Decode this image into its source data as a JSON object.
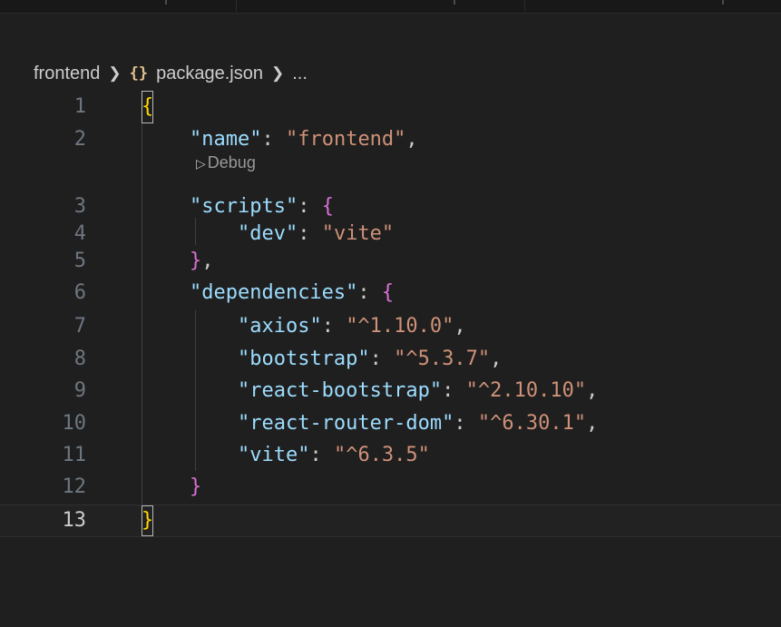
{
  "breadcrumb": {
    "folder": "frontend",
    "braces_icon": "{}",
    "file": "package.json",
    "ellipsis": "..."
  },
  "codelens": {
    "icon": "play-triangle",
    "label": "Debug"
  },
  "active_line": 13,
  "lines": [
    {
      "n": "1"
    },
    {
      "n": "2",
      "indent": "    ",
      "key": "\"name\"",
      "colon": ": ",
      "value": "\"frontend\"",
      "tail": ","
    },
    {
      "n": "3",
      "indent": "    ",
      "key": "\"scripts\"",
      "colon": ": ",
      "open": "{"
    },
    {
      "n": "4",
      "indent": "        ",
      "key": "\"dev\"",
      "colon": ": ",
      "value": "\"vite\""
    },
    {
      "n": "5",
      "indent": "    ",
      "close": "}",
      "tail": ","
    },
    {
      "n": "6",
      "indent": "    ",
      "key": "\"dependencies\"",
      "colon": ": ",
      "open": "{"
    },
    {
      "n": "7",
      "indent": "        ",
      "key": "\"axios\"",
      "colon": ": ",
      "value": "\"^1.10.0\"",
      "tail": ","
    },
    {
      "n": "8",
      "indent": "        ",
      "key": "\"bootstrap\"",
      "colon": ": ",
      "value": "\"^5.3.7\"",
      "tail": ","
    },
    {
      "n": "9",
      "indent": "        ",
      "key": "\"react-bootstrap\"",
      "colon": ": ",
      "value": "\"^2.10.10\"",
      "tail": ","
    },
    {
      "n": "10",
      "indent": "        ",
      "key": "\"react-router-dom\"",
      "colon": ": ",
      "value": "\"^6.30.1\"",
      "tail": ","
    },
    {
      "n": "11",
      "indent": "        ",
      "key": "\"vite\"",
      "colon": ": ",
      "value": "\"^6.3.5\""
    },
    {
      "n": "12",
      "indent": "    ",
      "close": "}"
    },
    {
      "n": "13"
    }
  ],
  "root_open": "{",
  "root_close": "}",
  "colors": {
    "background": "#1f1f1f",
    "key": "#9cdcfe",
    "string": "#ce9178",
    "bracket_level1": "#ffd700",
    "bracket_level2": "#da70d6",
    "line_number": "#6e7681"
  }
}
